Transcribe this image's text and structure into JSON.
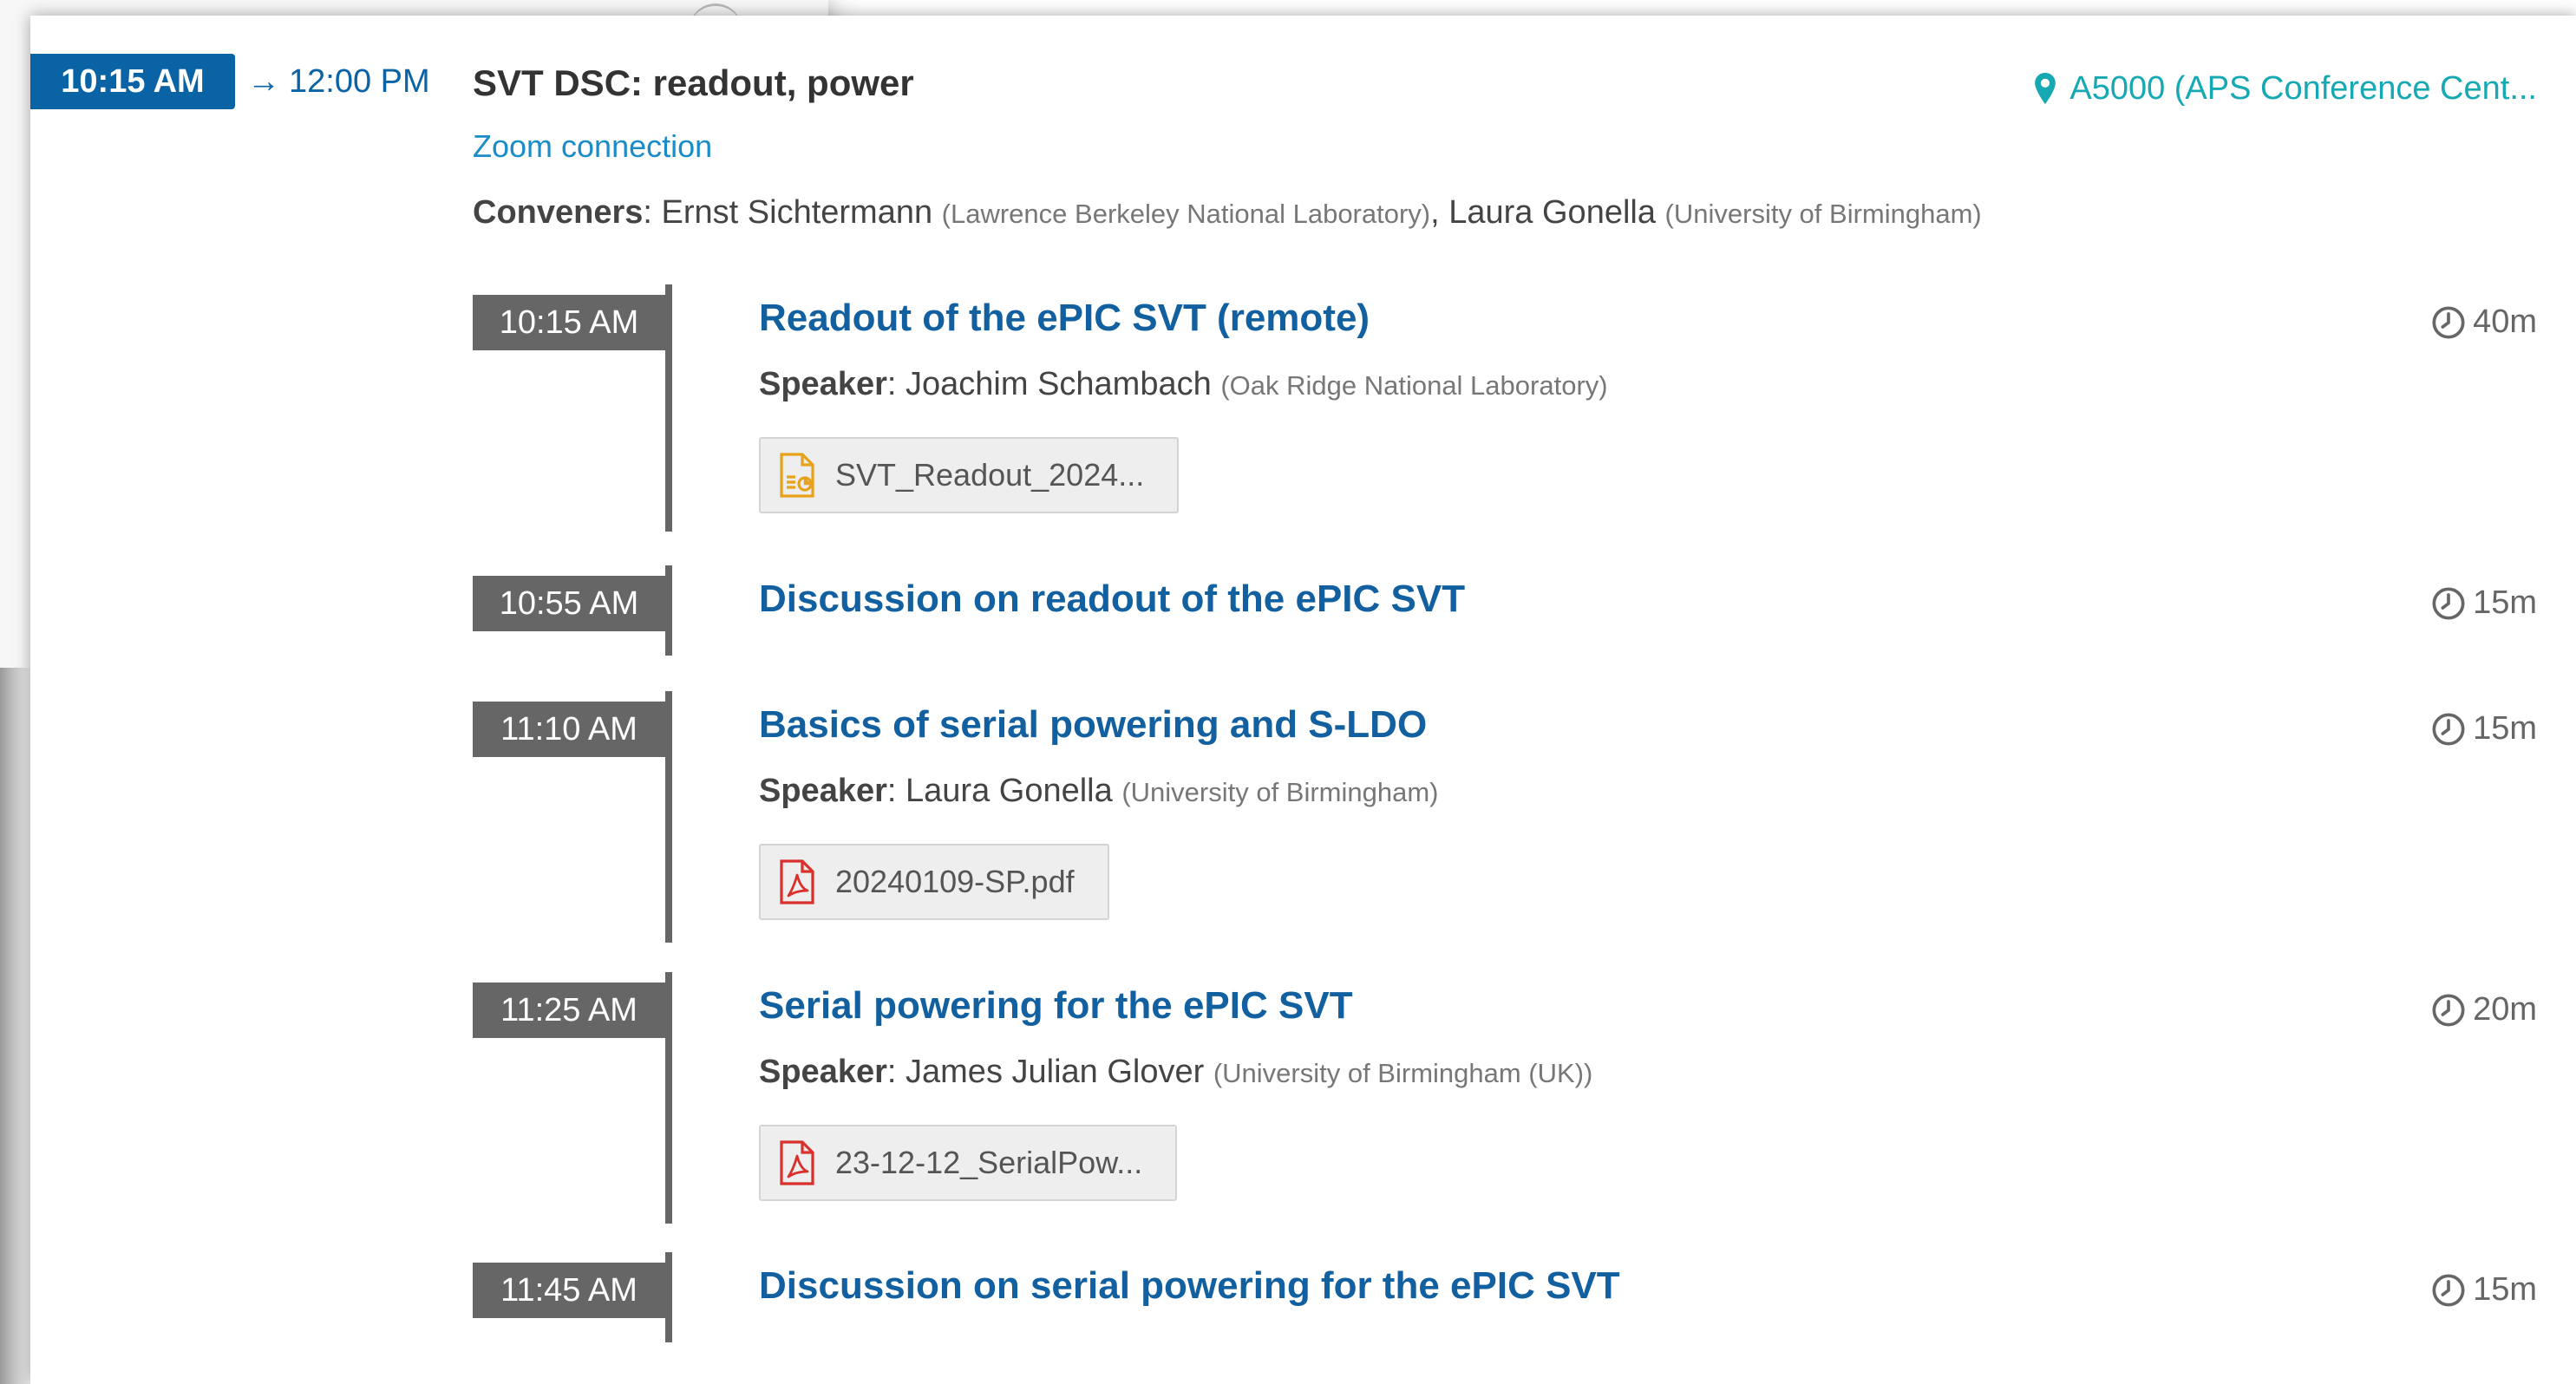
{
  "session": {
    "start": "10:15 AM",
    "end_arrow": "→",
    "end": "12:00 PM",
    "title": "SVT DSC: readout, power",
    "location": "A5000 (APS Conference Cent...",
    "zoom_link": "Zoom connection",
    "conveners_label": "Conveners",
    "conveners": [
      {
        "name": "Ernst Sichtermann",
        "affiliation": "(Lawrence Berkeley National Laboratory)"
      },
      {
        "name": "Laura Gonella",
        "affiliation": "(University of Birmingham)"
      }
    ]
  },
  "contributions": [
    {
      "time": "10:15 AM",
      "title": "Readout of the ePIC SVT (remote)",
      "duration": "40m",
      "speaker_label": "Speaker",
      "speaker": "Joachim Schambach",
      "affiliation": "(Oak Ridge National Laboratory)",
      "attachment": "SVT_Readout_2024...",
      "attachment_icon": "presentation-file-icon"
    },
    {
      "time": "10:55 AM",
      "title": "Discussion on readout of the ePIC SVT",
      "duration": "15m"
    },
    {
      "time": "11:10 AM",
      "title": "Basics of serial powering and S-LDO",
      "duration": "15m",
      "speaker_label": "Speaker",
      "speaker": "Laura Gonella",
      "affiliation": "(University of Birmingham)",
      "attachment": "20240109-SP.pdf",
      "attachment_icon": "pdf-file-icon"
    },
    {
      "time": "11:25 AM",
      "title": "Serial powering for the ePIC SVT",
      "duration": "20m",
      "speaker_label": "Speaker",
      "speaker": "James Julian Glover",
      "affiliation": "(University of Birmingham (UK))",
      "attachment": "23-12-12_SerialPow...",
      "attachment_icon": "pdf-file-icon"
    },
    {
      "time": "11:45 AM",
      "title": "Discussion on serial powering for the ePIC SVT",
      "duration": "15m"
    }
  ],
  "colors": {
    "accent_blue": "#0a63a5",
    "title_blue": "#12609f",
    "location_teal": "#16a8b3",
    "badge_gray": "#666666",
    "pdf_red": "#d9302c",
    "pres_orange": "#e8a11a"
  }
}
